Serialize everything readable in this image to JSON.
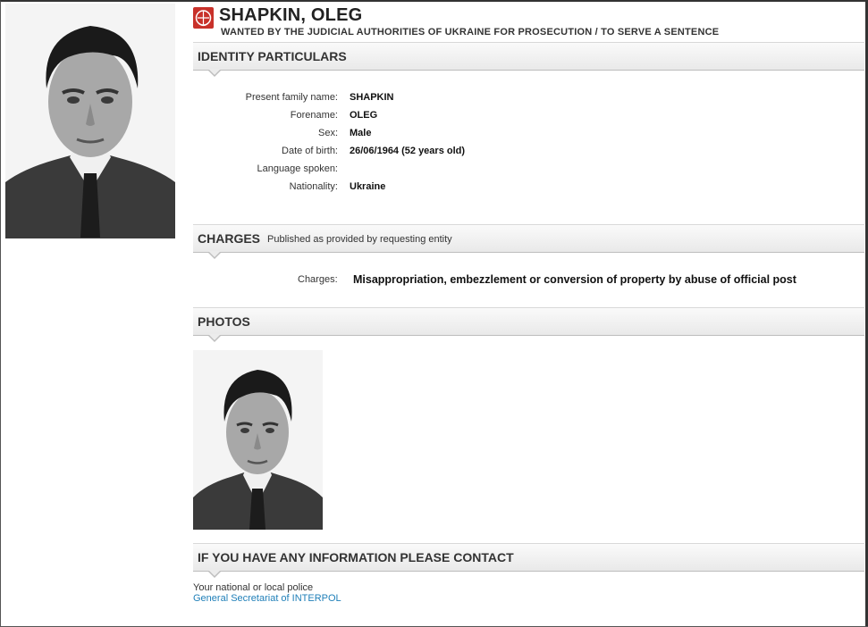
{
  "header": {
    "name": "SHAPKIN, OLEG",
    "subtitle": "WANTED BY THE JUDICIAL AUTHORITIES OF UKRAINE FOR PROSECUTION / TO SERVE A SENTENCE",
    "logo_icon": "interpol-emblem-icon",
    "logo_color": "#c8312a"
  },
  "identity": {
    "title": "IDENTITY PARTICULARS",
    "rows": [
      {
        "label": "Present family name:",
        "value": "SHAPKIN"
      },
      {
        "label": "Forename:",
        "value": "OLEG"
      },
      {
        "label": "Sex:",
        "value": "Male"
      },
      {
        "label": "Date of birth:",
        "value": "26/06/1964 (52 years old)"
      },
      {
        "label": "Language spoken:",
        "value": ""
      },
      {
        "label": "Nationality:",
        "value": "Ukraine"
      }
    ]
  },
  "charges": {
    "title": "CHARGES",
    "note": "Published as provided by requesting entity",
    "label": "Charges:",
    "value": "Misappropriation, embezzlement or conversion of property by abuse of official post"
  },
  "photos": {
    "title": "PHOTOS"
  },
  "contact": {
    "title": "IF YOU HAVE ANY INFORMATION PLEASE CONTACT",
    "line1": "Your national or local police",
    "link": "General Secretariat of INTERPOL",
    "link_color": "#1f7fb8"
  }
}
